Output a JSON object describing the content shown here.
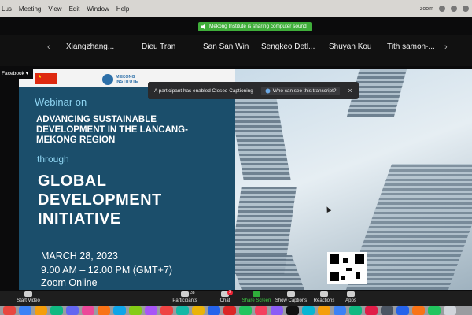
{
  "menubar": {
    "items": [
      "Lus",
      "Meeting",
      "View",
      "Edit",
      "Window",
      "Help"
    ],
    "share_text": "Mekong Institute is sharing computer sound",
    "right_label": "zoom"
  },
  "participants": [
    {
      "name": "Xiangzhang..."
    },
    {
      "name": "Dieu Tran"
    },
    {
      "name": "San San Win"
    },
    {
      "name": "Sengkeo Detl..."
    },
    {
      "name": "Shuyan Kou"
    },
    {
      "name": "Tith samon-..."
    }
  ],
  "nav": {
    "prev": "‹",
    "next": "›"
  },
  "facebook_label": "Facebook",
  "logo_text": "MEKONG\nINSTITUTE",
  "cc_notice": {
    "message": "A participant has enabled Closed Captioning",
    "link": "Who can see this transcript?",
    "close": "×"
  },
  "slide": {
    "webinar_on": "Webinar on",
    "headline": "ADVANCING SUSTAINABLE DEVELOPMENT IN THE LANCANG-MEKONG REGION",
    "through": "through",
    "initiative": "GLOBAL DEVELOPMENT INITIATIVE",
    "date": "MARCH 28, 2023",
    "time": "9.00 AM – 12.00 PM (GMT+7)",
    "venue": "Zoom Online"
  },
  "toolbar": {
    "start_video": "Start Video",
    "participants": "Participants",
    "participants_count": "38",
    "chat": "Chat",
    "chat_badge": "3",
    "share_screen": "Share Screen",
    "show_captions": "Show Captions",
    "reactions": "Reactions",
    "apps": "Apps"
  },
  "colors": {
    "slide_blue": "#1b4e6b",
    "accent_cyan": "#8fd5f2",
    "share_green": "#3fae3a"
  }
}
